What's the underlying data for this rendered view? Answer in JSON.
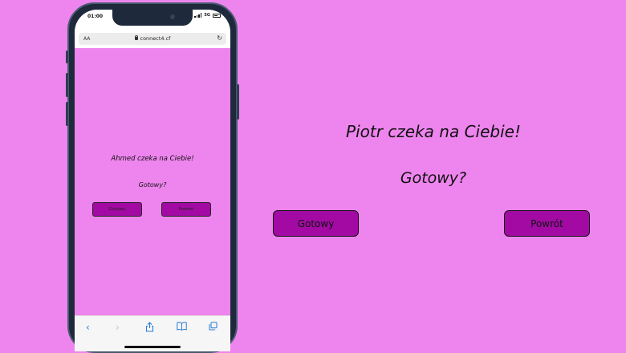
{
  "colors": {
    "background": "#ee85ee",
    "button": "#a30aa3",
    "phone_frame": "#1e2a3c",
    "toolbar_icon": "#2b7cd3"
  },
  "phone": {
    "status_time": "01:00",
    "network": "5G",
    "browser": {
      "text_size_label": "AA",
      "url": "connect4.cf",
      "reload_icon": "reload-icon"
    },
    "page": {
      "waiting_text": "Ahmed czeka na Ciebie!",
      "ready_text": "Gotowy?",
      "ready_button": "Gotowy",
      "back_button": "Powrót"
    },
    "toolbar": {
      "icons": [
        "back-icon",
        "forward-icon",
        "share-icon",
        "bookmarks-icon",
        "tabs-icon"
      ]
    }
  },
  "desktop": {
    "waiting_text": "Piotr czeka na Ciebie!",
    "ready_text": "Gotowy?",
    "ready_button": "Gotowy",
    "back_button": "Powrót"
  }
}
